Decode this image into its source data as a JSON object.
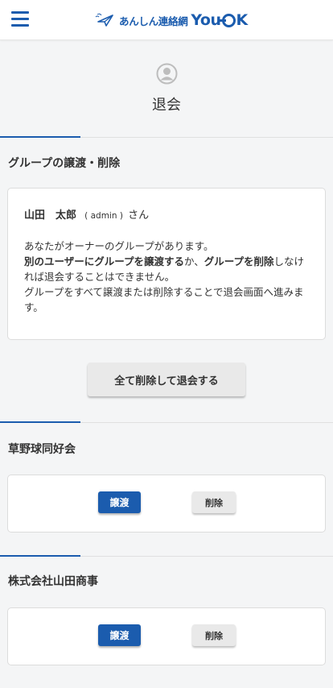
{
  "header": {
    "logo_text": "あんしん連絡網",
    "logo_brand_left": "You",
    "logo_brand_right": "K"
  },
  "page": {
    "title": "退会"
  },
  "section_main": {
    "heading": "グループの譲渡・削除",
    "user_name": "山田　太郎",
    "user_role": "( admin )",
    "honorific": "さん",
    "message_line1": "あなたがオーナーのグループがあります。",
    "msg_b1": "別のユーザーにグループを譲渡する",
    "msg_t1": "か、",
    "msg_b2": "グループを削除",
    "msg_t2": "しなければ退会することはできません。",
    "message_line3": "グループをすべて譲渡または削除することで退会画面へ進みます。",
    "delete_all_button": "全て削除して退会する"
  },
  "groups": [
    {
      "name": "草野球同好会",
      "transfer_label": "譲渡",
      "delete_label": "削除"
    },
    {
      "name": "株式会社山田商事",
      "transfer_label": "譲渡",
      "delete_label": "削除"
    }
  ],
  "colors": {
    "accent": "#1b5cae",
    "background": "#f4f5f6"
  },
  "icons": {
    "menu": "hamburger-menu-icon",
    "avatar": "user-avatar-icon",
    "logo": "airplane-logo-icon"
  }
}
